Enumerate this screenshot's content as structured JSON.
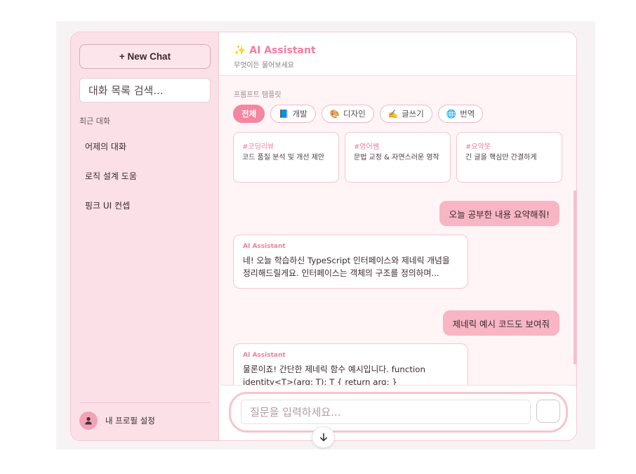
{
  "sidebar": {
    "new_chat_label": "+ New Chat",
    "search_placeholder": "대화 목록 검색...",
    "recent_label": "최근 대화",
    "chats": [
      "어제의 대화",
      "로직 설계 도움",
      "핑크 UI 컨셉"
    ],
    "profile_label": "내 프로필 설정"
  },
  "header": {
    "title": "✨ AI Assistant",
    "subtitle": "무엇이든 물어보세요"
  },
  "templates": {
    "label": "프롬프트 템플릿",
    "chips": [
      {
        "icon": "",
        "label": "전체",
        "active": true
      },
      {
        "icon": "📘",
        "label": "개발"
      },
      {
        "icon": "🎨",
        "label": "디자인"
      },
      {
        "icon": "✍️",
        "label": "글쓰기"
      },
      {
        "icon": "🌐",
        "label": "번역"
      }
    ],
    "cards": [
      {
        "tag": "#코딩리뷰",
        "desc": "코드 품질 분석 및 개선 제안"
      },
      {
        "tag": "#영어쌤",
        "desc": "문법 교정 & 자연스러운 영작"
      },
      {
        "tag": "#요약봇",
        "desc": "긴 글을 핵심만 간결하게"
      }
    ]
  },
  "messages": {
    "user_1": "오늘 공부한 내용 요약해줘!",
    "ai_1_name": "AI Assistant",
    "ai_1_text": "네! 오늘 학습하신 TypeScript 인터페이스와 제네릭 개념을 정리해드릴게요. 인터페이스는 객체의 구조를 정의하며...",
    "user_2": "제네릭 예시 코드도 보여줘",
    "ai_2_name": "AI Assistant",
    "ai_2_text": "물론이죠! 간단한 제네릭 함수 예시입니다. function identity<T>(arg: T): T { return arg; }"
  },
  "composer": {
    "placeholder": "질문을 입력하세요..."
  },
  "colors": {
    "accent": "#ef7f9d",
    "sidebar_bg": "#fbe0e7",
    "user_bubble": "#f8b5c4"
  }
}
